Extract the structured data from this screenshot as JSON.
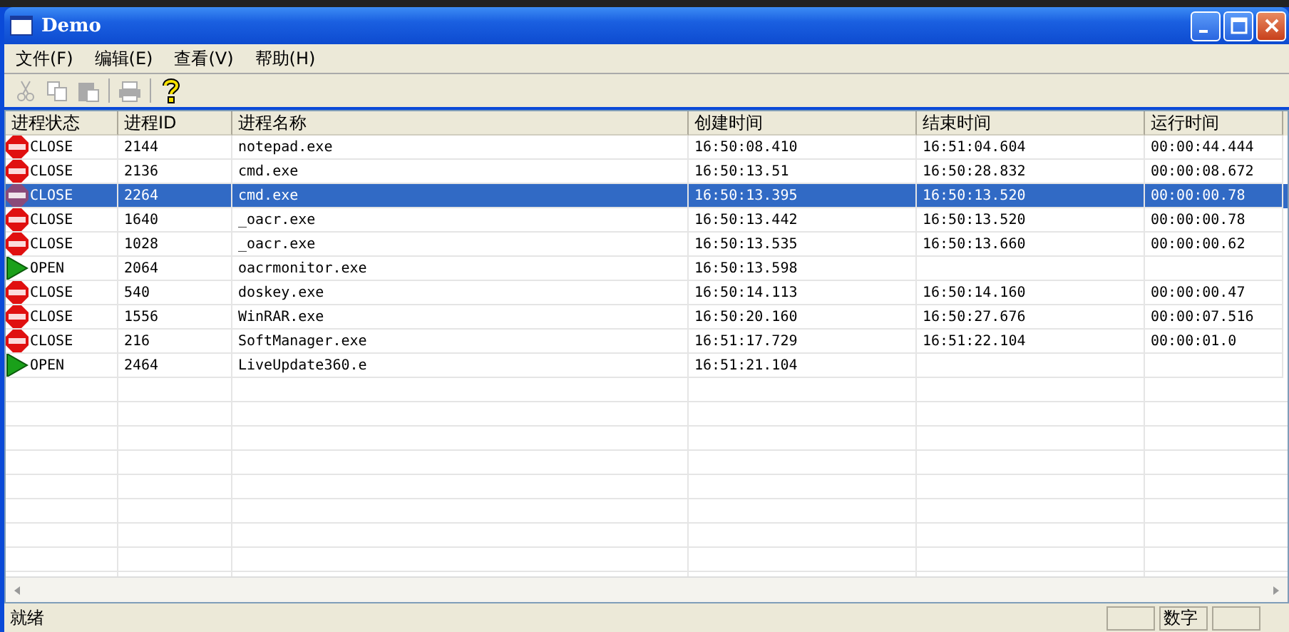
{
  "window": {
    "title": "Demo"
  },
  "menu": [
    "文件(F)",
    "编辑(E)",
    "查看(V)",
    "帮助(H)"
  ],
  "toolbar": [
    {
      "kind": "cut",
      "disabled": true
    },
    {
      "kind": "copy",
      "disabled": true
    },
    {
      "kind": "paste",
      "disabled": true
    },
    {
      "kind": "separator"
    },
    {
      "kind": "print",
      "disabled": true
    },
    {
      "kind": "separator"
    },
    {
      "kind": "help",
      "disabled": false
    }
  ],
  "table": {
    "columns": [
      "进程状态",
      "进程ID",
      "进程名称",
      "创建时间",
      "结束时间",
      "运行时间"
    ],
    "rows": [
      {
        "kind": "stop",
        "status": "CLOSE",
        "pid": "2144",
        "name": "notepad.exe",
        "created": "16:50:08.410",
        "ended": "16:51:04.604",
        "runtime": "00:00:44.444",
        "selected": false
      },
      {
        "kind": "stop",
        "status": "CLOSE",
        "pid": "2136",
        "name": "cmd.exe",
        "created": "16:50:13.51",
        "ended": "16:50:28.832",
        "runtime": "00:00:08.672",
        "selected": false
      },
      {
        "kind": "stop",
        "status": "CLOSE",
        "pid": "2264",
        "name": "cmd.exe",
        "created": "16:50:13.395",
        "ended": "16:50:13.520",
        "runtime": "00:00:00.78",
        "selected": true
      },
      {
        "kind": "stop",
        "status": "CLOSE",
        "pid": "1640",
        "name": "_oacr.exe",
        "created": "16:50:13.442",
        "ended": "16:50:13.520",
        "runtime": "00:00:00.78",
        "selected": false
      },
      {
        "kind": "stop",
        "status": "CLOSE",
        "pid": "1028",
        "name": "_oacr.exe",
        "created": "16:50:13.535",
        "ended": "16:50:13.660",
        "runtime": "00:00:00.62",
        "selected": false
      },
      {
        "kind": "play",
        "status": "OPEN",
        "pid": "2064",
        "name": "oacrmonitor.exe",
        "created": "16:50:13.598",
        "selected": false
      },
      {
        "kind": "stop",
        "status": "CLOSE",
        "pid": "540",
        "name": "doskey.exe",
        "created": "16:50:14.113",
        "ended": "16:50:14.160",
        "runtime": "00:00:00.47",
        "selected": false
      },
      {
        "kind": "stop",
        "status": "CLOSE",
        "pid": "1556",
        "name": "WinRAR.exe",
        "created": "16:50:20.160",
        "ended": "16:50:27.676",
        "runtime": "00:00:07.516",
        "selected": false
      },
      {
        "kind": "stop",
        "status": "CLOSE",
        "pid": "216",
        "name": "SoftManager.exe",
        "created": "16:51:17.729",
        "ended": "16:51:22.104",
        "runtime": "00:00:01.0",
        "selected": false
      },
      {
        "kind": "play",
        "status": "OPEN",
        "pid": "2464",
        "name": "LiveUpdate360.e",
        "created": "16:51:21.104",
        "selected": false
      }
    ]
  },
  "status_bar": {
    "message": "就绪",
    "indicator": "数字"
  }
}
